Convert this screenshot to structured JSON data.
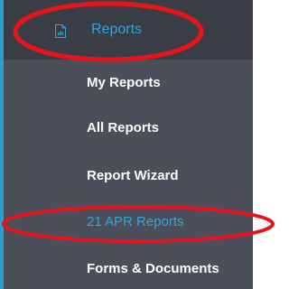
{
  "sidebar": {
    "accent_color": "#2fa6da",
    "background_color": "#4b4f59",
    "header": {
      "label": "Reports",
      "icon": "document-icon"
    },
    "items": [
      {
        "label": "My Reports"
      },
      {
        "label": "All Reports"
      },
      {
        "label": "Report Wizard"
      },
      {
        "label": "21 APR Reports",
        "active": true
      },
      {
        "label": "Forms & Documents"
      }
    ]
  },
  "annotations": {
    "highlight_color": "#e8141b",
    "shape": "ellipse",
    "circled_items": [
      "Reports",
      "21 APR Reports"
    ]
  }
}
